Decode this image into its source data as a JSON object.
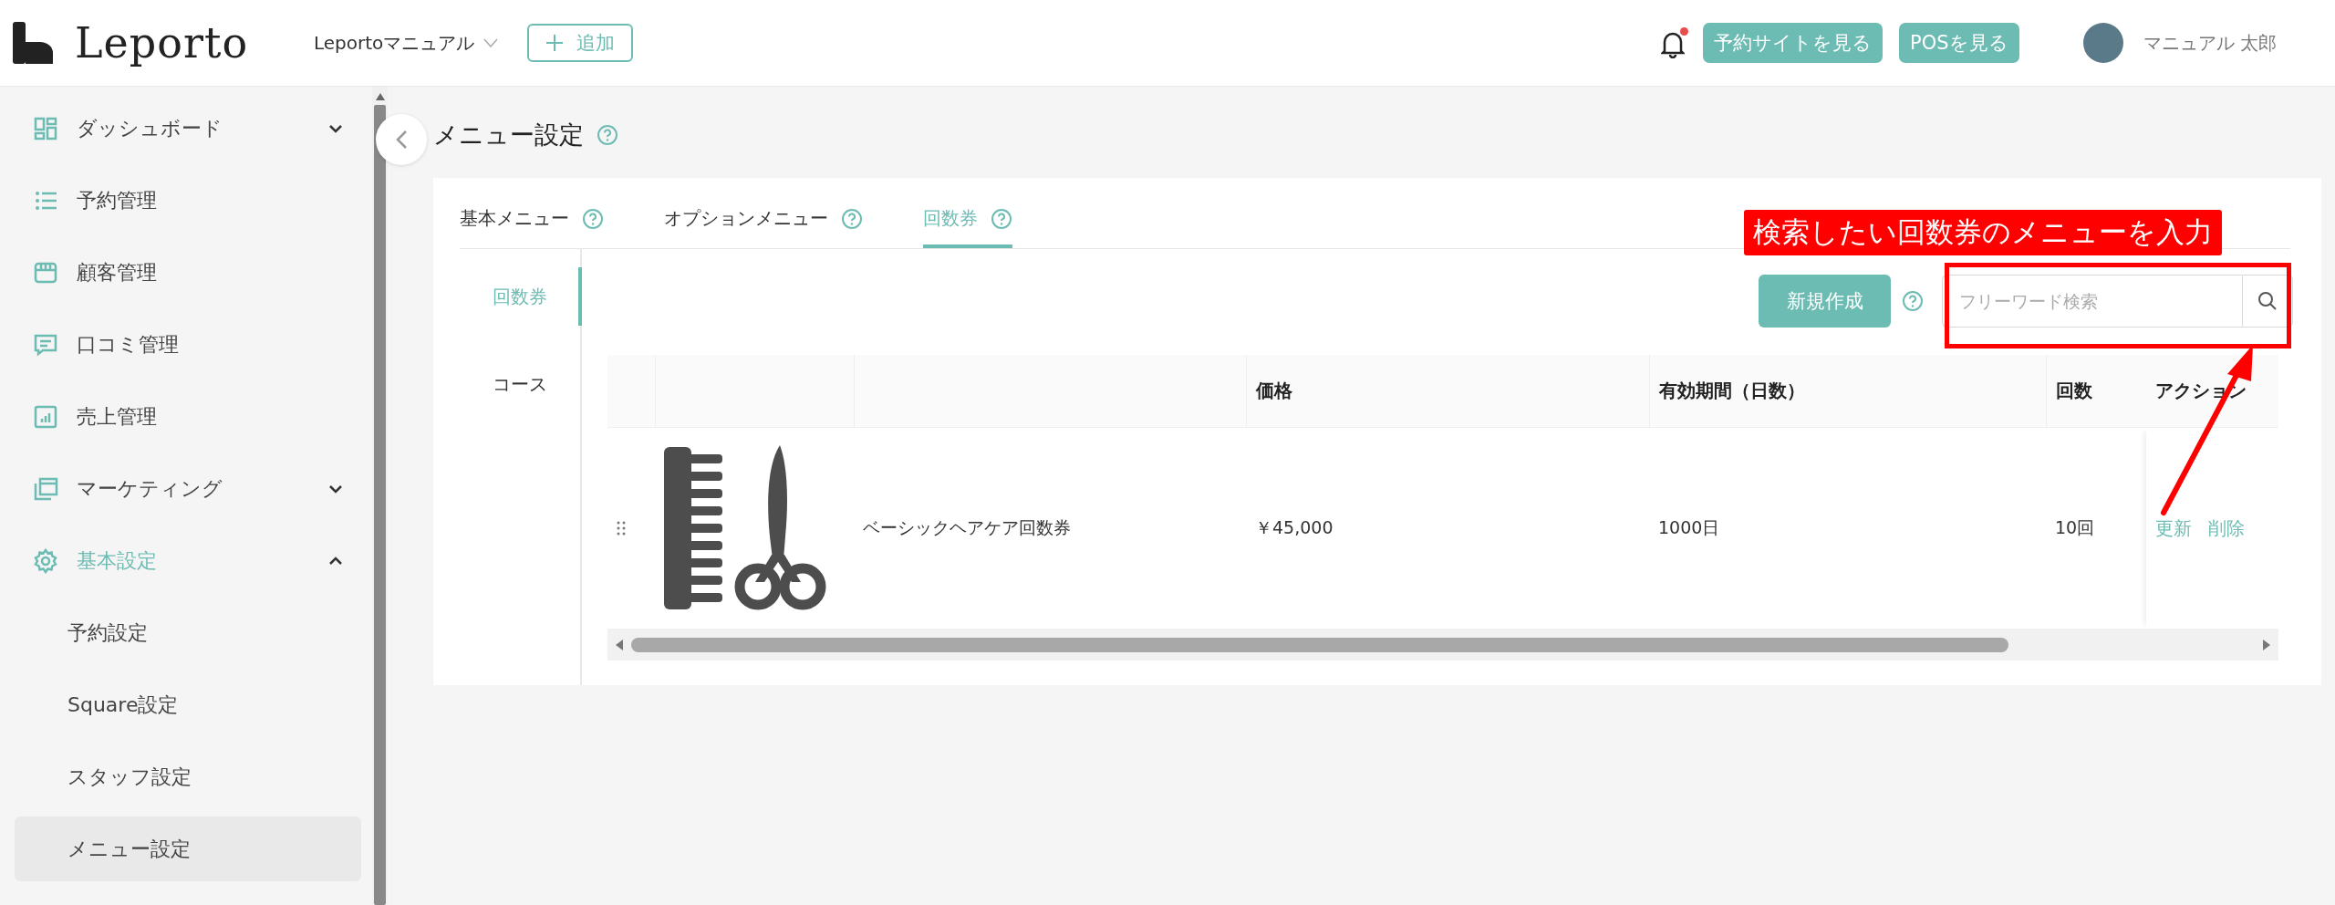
{
  "header": {
    "logo": "Leporto",
    "store": "Leportoマニュアル",
    "add_button": "追加",
    "notification": {
      "unread": true
    },
    "buttons": [
      "予約サイトを見る",
      "POSを見る"
    ],
    "user_name": "マニュアル 太郎"
  },
  "sidebar": {
    "items": [
      {
        "kind": "dashboard",
        "label": "ダッシュボード",
        "expandable": true,
        "expanded": false,
        "active": false
      },
      {
        "kind": "list",
        "label": "予約管理",
        "expandable": false,
        "active": false
      },
      {
        "kind": "store",
        "label": "顧客管理",
        "expandable": false,
        "active": false
      },
      {
        "kind": "comment",
        "label": "口コミ管理",
        "expandable": false,
        "active": false
      },
      {
        "kind": "chart",
        "label": "売上管理",
        "expandable": false,
        "active": false
      },
      {
        "kind": "window",
        "label": "マーケティング",
        "expandable": true,
        "expanded": false,
        "active": false
      },
      {
        "kind": "gear",
        "label": "基本設定",
        "expandable": true,
        "expanded": true,
        "active": true,
        "children": [
          {
            "label": "予約設定",
            "selected": false
          },
          {
            "label": "Square設定",
            "selected": false
          },
          {
            "label": "スタッフ設定",
            "selected": false
          },
          {
            "label": "メニュー設定",
            "selected": true
          }
        ]
      }
    ]
  },
  "page": {
    "title": "メニュー設定"
  },
  "tabs": [
    {
      "label": "基本メニュー",
      "selected": false
    },
    {
      "label": "オプションメニュー",
      "selected": false
    },
    {
      "label": "回数券",
      "selected": true
    }
  ],
  "subnav": [
    {
      "label": "回数券",
      "selected": true
    },
    {
      "label": "コース",
      "selected": false
    }
  ],
  "toolbar": {
    "new_button": "新規作成",
    "search": {
      "placeholder": "フリーワード検索"
    }
  },
  "table": {
    "columns": [
      "価格",
      "有効期間（日数）",
      "回数",
      "アクション"
    ],
    "rows": [
      {
        "name": "ベーシックヘアケア回数券",
        "price": "￥45,000",
        "period": "1000日",
        "count": "10回",
        "actions": [
          "更新",
          "削除"
        ]
      }
    ]
  },
  "annotation": {
    "text": "検索したい回数券のメニューを入力"
  }
}
